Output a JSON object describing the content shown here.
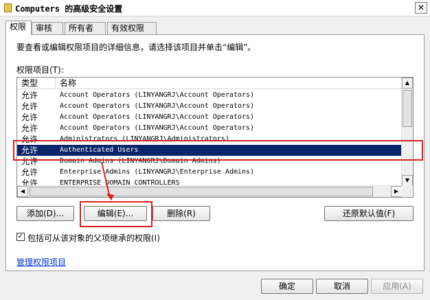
{
  "window": {
    "title": "Computers 的高级安全设置",
    "close_glyph": "✕",
    "folder_icon": "folder-icon"
  },
  "tabs": [
    {
      "label": "权限",
      "active": true
    },
    {
      "label": "审核",
      "active": false
    },
    {
      "label": "所有者",
      "active": false
    },
    {
      "label": "有效权限",
      "active": false
    }
  ],
  "description": "要查看或编辑权限项目的详细信息，请选择该项目并单击“编辑”。",
  "list": {
    "label": "权限项目(T):",
    "columns": [
      "类型",
      "名称"
    ],
    "rows": [
      {
        "type": "允许",
        "name": "Account Operators (LINYANGRJ\\Account Operators)",
        "selected": false
      },
      {
        "type": "允许",
        "name": "Account Operators (LINYANGRJ\\Account Operators)",
        "selected": false
      },
      {
        "type": "允许",
        "name": "Account Operators (LINYANGRJ\\Account Operators)",
        "selected": false
      },
      {
        "type": "允许",
        "name": "Account Operators (LINYANGRJ\\Account Operators)",
        "selected": false
      },
      {
        "type": "允许",
        "name": "Administrators (LINYANGRJ\\Administrators)",
        "selected": false
      },
      {
        "type": "允许",
        "name": "Authenticated Users",
        "selected": true
      },
      {
        "type": "允许",
        "name": "Domain Admins (LINYANGRJ\\Domain Admins)",
        "selected": false
      },
      {
        "type": "允许",
        "name": "Enterprise Admins (LINYANGRJ\\Enterprise Admins)",
        "selected": false
      },
      {
        "type": "允许",
        "name": "ENTERPRISE DOMAIN CONTROLLERS",
        "selected": false
      }
    ],
    "scroll_up_glyph": "▲",
    "scroll_down_glyph": "▼",
    "scroll_left_glyph": "◀",
    "scroll_right_glyph": "▶"
  },
  "buttons": {
    "add": "添加(D)...",
    "edit": "编辑(E)...",
    "remove": "删除(R)",
    "restore_defaults": "还原默认值(F)"
  },
  "inherit_checkbox": {
    "label": "包括可从该对象的父项继承的权限(I)",
    "checked": true,
    "check_glyph": "✓"
  },
  "manage_link": "管理权限项目",
  "footer": {
    "ok": "确定",
    "cancel": "取消",
    "apply": "应用(A)"
  },
  "colors": {
    "selection": "#0a246a",
    "annotation": "#d42020",
    "link": "#0033cc"
  }
}
